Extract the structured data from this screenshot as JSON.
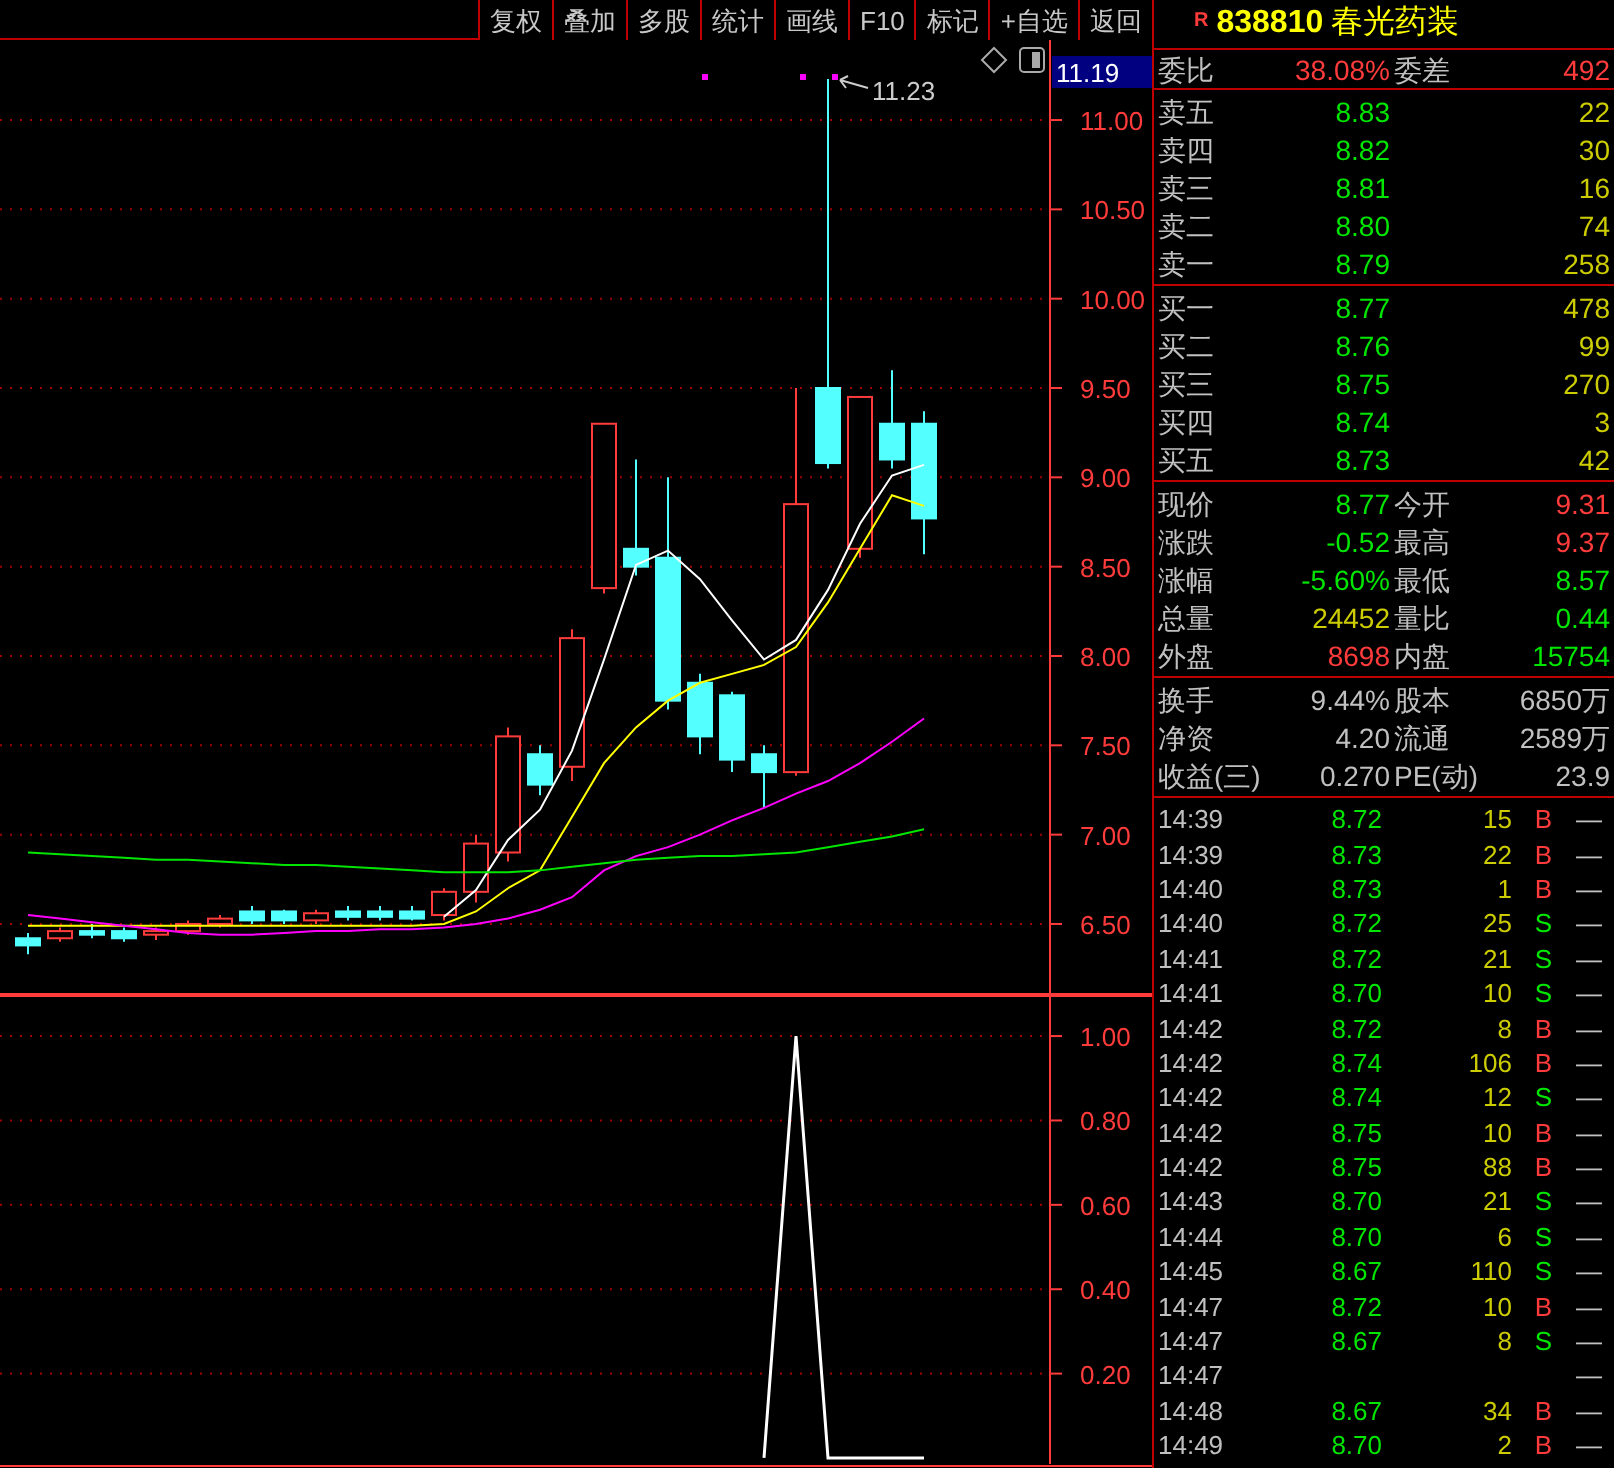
{
  "toolbar": [
    {
      "label": "复权"
    },
    {
      "label": "叠加"
    },
    {
      "label": "多股"
    },
    {
      "label": "统计"
    },
    {
      "label": "画线"
    },
    {
      "label": "F10"
    },
    {
      "label": "标记"
    },
    {
      "label": "+自选"
    },
    {
      "label": "返回"
    }
  ],
  "price_chart": {
    "last_price_tag": "11.19",
    "high_label": "11.23",
    "chart_data": {
      "type": "candlestick",
      "grid": true,
      "ylim": [
        6.108,
        11.448
      ],
      "categories": [
        null,
        null,
        null,
        null,
        null,
        null,
        null,
        null,
        null,
        null,
        null,
        null,
        null,
        null,
        null,
        null,
        null,
        null,
        null,
        null,
        null,
        null,
        null,
        null,
        null,
        null,
        null,
        null,
        null
      ],
      "yticks": [
        {
          "value": 11,
          "label": "11.00"
        },
        {
          "value": 10.5,
          "label": "10.50"
        },
        {
          "value": 10,
          "label": "10.00"
        },
        {
          "value": 9.5,
          "label": "9.50"
        },
        {
          "value": 9,
          "label": "9.00"
        },
        {
          "value": 8.5,
          "label": "8.50"
        },
        {
          "value": 8,
          "label": "8.00"
        },
        {
          "value": 7.5,
          "label": "7.50"
        },
        {
          "value": 7,
          "label": "7.00"
        },
        {
          "value": 6.5,
          "label": "6.50"
        }
      ],
      "ohlc": [
        [
          6.42,
          6.45,
          6.33,
          6.38
        ],
        [
          6.42,
          6.48,
          6.4,
          6.46
        ],
        [
          6.46,
          6.5,
          6.42,
          6.44
        ],
        [
          6.46,
          6.48,
          6.4,
          6.42
        ],
        [
          6.44,
          6.48,
          6.41,
          6.46
        ],
        [
          6.46,
          6.52,
          6.44,
          6.5
        ],
        [
          6.5,
          6.55,
          6.48,
          6.53
        ],
        [
          6.57,
          6.6,
          6.5,
          6.52
        ],
        [
          6.57,
          6.58,
          6.5,
          6.52
        ],
        [
          6.52,
          6.58,
          6.5,
          6.56
        ],
        [
          6.57,
          6.6,
          6.52,
          6.54
        ],
        [
          6.57,
          6.6,
          6.52,
          6.54
        ],
        [
          6.57,
          6.6,
          6.52,
          6.53
        ],
        [
          6.55,
          6.7,
          6.52,
          6.68
        ],
        [
          6.68,
          7.0,
          6.62,
          6.95
        ],
        [
          6.9,
          7.6,
          6.85,
          7.55
        ],
        [
          7.45,
          7.5,
          7.22,
          7.28
        ],
        [
          7.38,
          8.15,
          7.3,
          8.1
        ],
        [
          8.38,
          9.3,
          8.35,
          9.3
        ],
        [
          8.6,
          9.1,
          8.45,
          8.5
        ],
        [
          8.55,
          9.0,
          7.7,
          7.75
        ],
        [
          7.85,
          7.9,
          7.45,
          7.55
        ],
        [
          7.78,
          7.8,
          7.35,
          7.42
        ],
        [
          7.45,
          7.5,
          7.15,
          7.35
        ],
        [
          7.35,
          9.5,
          7.33,
          8.85
        ],
        [
          9.5,
          11.23,
          9.05,
          9.08
        ],
        [
          8.6,
          9.45,
          8.55,
          9.45
        ],
        [
          9.3,
          9.6,
          9.05,
          9.1
        ],
        [
          9.3,
          9.37,
          8.57,
          8.77
        ]
      ],
      "series": [
        {
          "type": "line",
          "color": "#ffffff",
          "values": [
            null,
            null,
            null,
            null,
            null,
            null,
            null,
            null,
            null,
            null,
            null,
            null,
            null,
            6.54,
            6.69,
            6.97,
            7.14,
            7.47,
            7.98,
            8.51,
            8.59,
            8.43,
            8.2,
            7.98,
            8.09,
            8.37,
            8.74,
            9.01,
            9.07
          ]
        },
        {
          "type": "line",
          "color": "#ffff00",
          "values": [
            6.49,
            6.49,
            6.49,
            6.49,
            6.49,
            6.49,
            6.49,
            6.49,
            6.49,
            6.49,
            6.49,
            6.49,
            6.49,
            6.5,
            6.57,
            6.7,
            6.8,
            7.1,
            7.4,
            7.6,
            7.75,
            7.85,
            7.9,
            7.95,
            8.05,
            8.3,
            8.6,
            8.9,
            8.84
          ]
        },
        {
          "type": "line",
          "color": "#ff00ff",
          "values": [
            6.55,
            6.53,
            6.51,
            6.49,
            6.47,
            6.45,
            6.44,
            6.44,
            6.45,
            6.46,
            6.46,
            6.47,
            6.47,
            6.48,
            6.5,
            6.53,
            6.58,
            6.65,
            6.8,
            6.88,
            6.93,
            7.0,
            7.08,
            7.15,
            7.23,
            7.3,
            7.4,
            7.52,
            7.65
          ]
        },
        {
          "type": "line",
          "color": "#00e600",
          "values": [
            6.9,
            6.89,
            6.88,
            6.87,
            6.86,
            6.86,
            6.85,
            6.84,
            6.83,
            6.83,
            6.82,
            6.81,
            6.8,
            6.79,
            6.79,
            6.79,
            6.8,
            6.82,
            6.84,
            6.86,
            6.87,
            6.88,
            6.88,
            6.89,
            6.9,
            6.93,
            6.96,
            6.99,
            7.03
          ]
        }
      ]
    }
  },
  "indicator_chart": {
    "chart_data": {
      "type": "line",
      "grid": true,
      "ylim": [
        -0.019,
        1.095
      ],
      "categories": [
        null,
        null,
        null,
        null,
        null,
        null,
        null,
        null,
        null,
        null,
        null,
        null,
        null,
        null,
        null,
        null,
        null,
        null,
        null,
        null,
        null,
        null,
        null,
        null,
        null,
        null,
        null,
        null,
        null
      ],
      "yticks": [
        {
          "value": 1,
          "label": "1.00"
        },
        {
          "value": 0.8,
          "label": "0.80"
        },
        {
          "value": 0.6,
          "label": "0.60"
        },
        {
          "value": 0.4,
          "label": "0.40"
        },
        {
          "value": 0.2,
          "label": "0.20"
        }
      ],
      "series": [
        {
          "color": "#ffffff",
          "values": [
            null,
            null,
            null,
            null,
            null,
            null,
            null,
            null,
            null,
            null,
            null,
            null,
            null,
            null,
            null,
            null,
            null,
            null,
            null,
            null,
            null,
            null,
            null,
            0,
            1,
            0,
            0,
            0,
            0
          ]
        }
      ]
    }
  },
  "quote": {
    "badge": "R",
    "code": "838810",
    "name": "春光药装",
    "ratio": {
      "label": "委比",
      "value": "38.08%",
      "label2": "委差",
      "value2": "492"
    },
    "asks": [
      {
        "label": "卖五",
        "price": "8.83",
        "volume": "22"
      },
      {
        "label": "卖四",
        "price": "8.82",
        "volume": "30"
      },
      {
        "label": "卖三",
        "price": "8.81",
        "volume": "16"
      },
      {
        "label": "卖二",
        "price": "8.80",
        "volume": "74"
      },
      {
        "label": "卖一",
        "price": "8.79",
        "volume": "258"
      }
    ],
    "bids": [
      {
        "label": "买一",
        "price": "8.77",
        "volume": "478"
      },
      {
        "label": "买二",
        "price": "8.76",
        "volume": "99"
      },
      {
        "label": "买三",
        "price": "8.75",
        "volume": "270"
      },
      {
        "label": "买四",
        "price": "8.74",
        "volume": "3"
      },
      {
        "label": "买五",
        "price": "8.73",
        "volume": "42"
      }
    ],
    "stats": [
      {
        "label": "现价",
        "value": "8.77",
        "color": "#00e600"
      },
      {
        "label": "今开",
        "value": "9.31",
        "color": "#ff3b3b"
      },
      {
        "label": "涨跌",
        "value": "-0.52",
        "color": "#00e600"
      },
      {
        "label": "最高",
        "value": "9.37",
        "color": "#ff3b3b"
      },
      {
        "label": "涨幅",
        "value": "-5.60%",
        "color": "#00e600"
      },
      {
        "label": "最低",
        "value": "8.57",
        "color": "#00e600"
      },
      {
        "label": "总量",
        "value": "24452",
        "color": "#cccc00"
      },
      {
        "label": "量比",
        "value": "0.44",
        "color": "#00e600"
      },
      {
        "label": "外盘",
        "value": "8698",
        "color": "#ff3b3b"
      },
      {
        "label": "内盘",
        "value": "15754",
        "color": "#00e600"
      }
    ],
    "fundamentals": [
      {
        "label": "换手",
        "value": "9.44%"
      },
      {
        "label": "股本",
        "value": "6850万"
      },
      {
        "label": "净资",
        "value": "4.20"
      },
      {
        "label": "流通",
        "value": "2589万"
      },
      {
        "label": "收益(三)",
        "value": "0.270"
      },
      {
        "label": "PE(动)",
        "value": "23.9"
      }
    ]
  },
  "trades": [
    {
      "time": "14:39",
      "price": "8.72",
      "volume": "15",
      "side": "B",
      "kind": "buy",
      "mark": "—"
    },
    {
      "time": "14:39",
      "price": "8.73",
      "volume": "22",
      "side": "B",
      "kind": "buy",
      "mark": "—"
    },
    {
      "time": "14:40",
      "price": "8.73",
      "volume": "1",
      "side": "B",
      "kind": "buy",
      "mark": "—"
    },
    {
      "time": "14:40",
      "price": "8.72",
      "volume": "25",
      "side": "S",
      "kind": "sell",
      "mark": "—"
    },
    {
      "time": "14:41",
      "price": "8.72",
      "volume": "21",
      "side": "S",
      "kind": "sell",
      "mark": "—"
    },
    {
      "time": "14:41",
      "price": "8.70",
      "volume": "10",
      "side": "S",
      "kind": "sell",
      "mark": "—"
    },
    {
      "time": "14:42",
      "price": "8.72",
      "volume": "8",
      "side": "B",
      "kind": "buy",
      "mark": "—"
    },
    {
      "time": "14:42",
      "price": "8.74",
      "volume": "106",
      "side": "B",
      "kind": "buy",
      "mark": "—"
    },
    {
      "time": "14:42",
      "price": "8.74",
      "volume": "12",
      "side": "S",
      "kind": "sell",
      "mark": "—"
    },
    {
      "time": "14:42",
      "price": "8.75",
      "volume": "10",
      "side": "B",
      "kind": "buy",
      "mark": "—"
    },
    {
      "time": "14:42",
      "price": "8.75",
      "volume": "88",
      "side": "B",
      "kind": "buy",
      "mark": "—"
    },
    {
      "time": "14:43",
      "price": "8.70",
      "volume": "21",
      "side": "S",
      "kind": "sell",
      "mark": "—"
    },
    {
      "time": "14:44",
      "price": "8.70",
      "volume": "6",
      "side": "S",
      "kind": "sell",
      "mark": "—"
    },
    {
      "time": "14:45",
      "price": "8.67",
      "volume": "110",
      "side": "S",
      "kind": "sell",
      "mark": "—"
    },
    {
      "time": "14:47",
      "price": "8.72",
      "volume": "10",
      "side": "B",
      "kind": "buy",
      "mark": "—"
    },
    {
      "time": "14:47",
      "price": "8.67",
      "volume": "8",
      "side": "S",
      "kind": "sell",
      "mark": "—"
    },
    {
      "time": "14:47",
      "mark": "—"
    },
    {
      "time": "14:48",
      "price": "8.67",
      "volume": "34",
      "side": "B",
      "kind": "buy",
      "mark": "—"
    },
    {
      "time": "14:49",
      "price": "8.70",
      "volume": "2",
      "side": "B",
      "kind": "buy",
      "mark": "—"
    }
  ]
}
